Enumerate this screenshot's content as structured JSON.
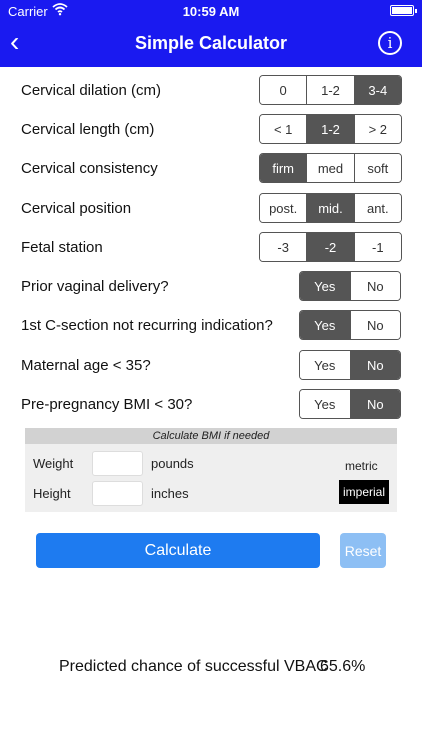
{
  "status_bar": {
    "carrier": "Carrier",
    "time": "10:59 AM"
  },
  "nav": {
    "title": "Simple Calculator",
    "back_glyph": "‹",
    "info_glyph": "i"
  },
  "fields": [
    {
      "label": "Cervical dilation (cm)",
      "options": [
        "0",
        "1-2",
        "3-4"
      ],
      "selected": 2
    },
    {
      "label": "Cervical length (cm)",
      "options": [
        "< 1",
        "1-2",
        "> 2"
      ],
      "selected": 1
    },
    {
      "label": "Cervical consistency",
      "options": [
        "firm",
        "med",
        "soft"
      ],
      "selected": 0
    },
    {
      "label": "Cervical position",
      "options": [
        "post.",
        "mid.",
        "ant."
      ],
      "selected": 1
    },
    {
      "label": "Fetal station",
      "options": [
        "-3",
        "-2",
        "-1"
      ],
      "selected": 1
    },
    {
      "label": "Prior vaginal delivery?",
      "options": [
        "Yes",
        "No"
      ],
      "selected": 0
    },
    {
      "label": "1st C-section not recurring indication?",
      "options": [
        "Yes",
        "No"
      ],
      "selected": 0
    },
    {
      "label": "Maternal age < 35?",
      "options": [
        "Yes",
        "No"
      ],
      "selected": 1
    },
    {
      "label": "Pre-pregnancy BMI < 30?",
      "options": [
        "Yes",
        "No"
      ],
      "selected": 1
    }
  ],
  "bmi": {
    "header": "Calculate BMI if needed",
    "weight_label": "Weight",
    "weight_value": "",
    "weight_unit": "pounds",
    "height_label": "Height",
    "height_value": "",
    "height_unit": "inches",
    "metric_label": "metric",
    "imperial_label": "imperial"
  },
  "actions": {
    "calculate_label": "Calculate",
    "reset_label": "Reset"
  },
  "result": {
    "label": "Predicted chance of successful VBAC",
    "value": "65.6%"
  },
  "colors": {
    "nav_bg": "#1a1af0",
    "calculate_bg": "#1e7bf0",
    "reset_bg": "#8dbff4",
    "segment_selected": "#555555"
  },
  "icons": {
    "wifi": "wifi-icon",
    "battery": "battery-icon",
    "back": "back-chevron-icon",
    "info": "info-icon"
  }
}
